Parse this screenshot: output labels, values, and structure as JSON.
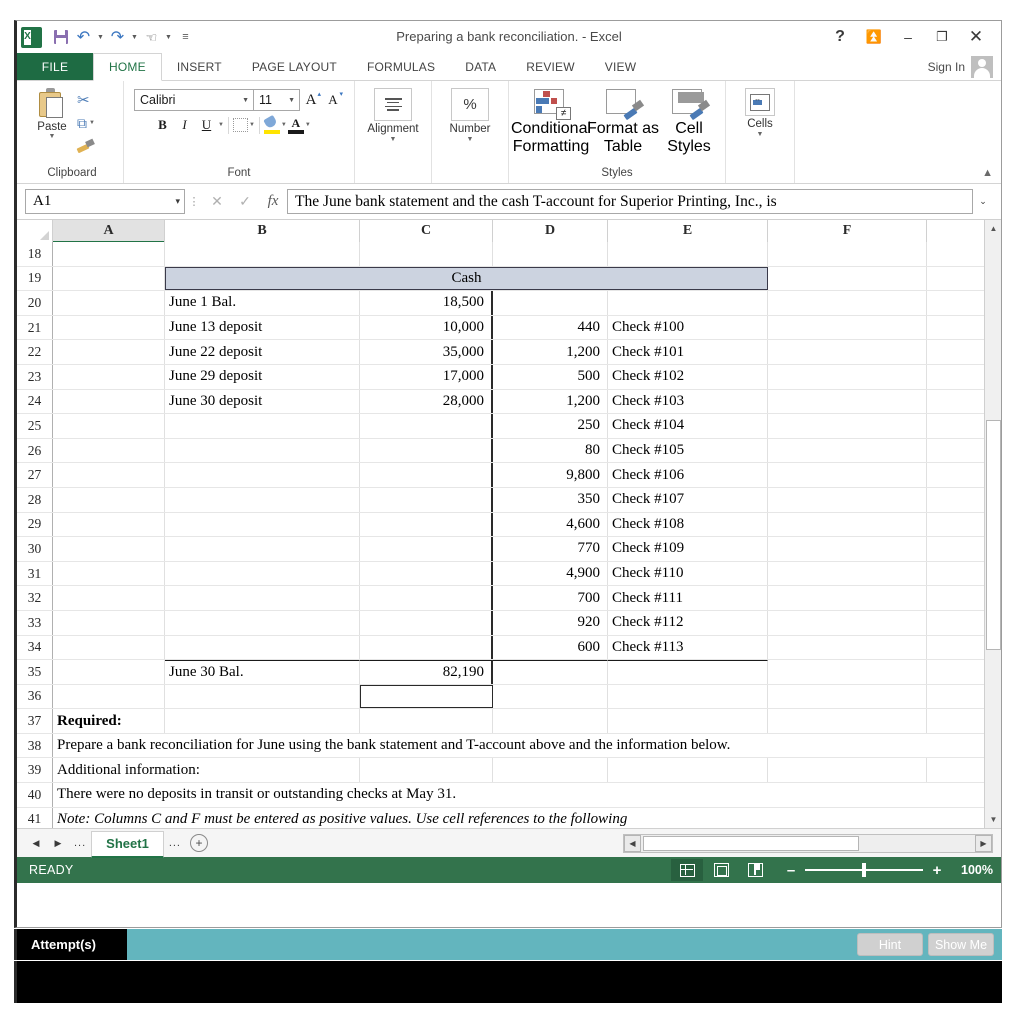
{
  "window": {
    "title": "Preparing a bank reconciliation. - Excel",
    "qat": [
      {
        "name": "save",
        "icon": "save-icon"
      },
      {
        "name": "undo",
        "icon": "undo-icon"
      },
      {
        "name": "redo",
        "icon": "redo-icon"
      },
      {
        "name": "touch-mode",
        "icon": "touch-mode-icon"
      },
      {
        "name": "customize",
        "icon": "more-icon"
      }
    ],
    "controls": {
      "help": "?",
      "ribbon_display": "⤒",
      "minimize": "–",
      "restore": "❐",
      "close": "✕"
    }
  },
  "ribbon": {
    "file_tab": "FILE",
    "tabs": [
      "HOME",
      "INSERT",
      "PAGE LAYOUT",
      "FORMULAS",
      "DATA",
      "REVIEW",
      "VIEW"
    ],
    "active_tab": "HOME",
    "sign_in": "Sign In",
    "collapse_icon": "chevron-up-icon",
    "groups": {
      "clipboard": {
        "label": "Clipboard",
        "paste": "Paste",
        "cut": "cut-icon",
        "copy": "copy-icon",
        "format_painter": "format-painter-icon"
      },
      "font": {
        "label": "Font",
        "font_name": "Calibri",
        "font_size": "11",
        "grow_font": "A",
        "shrink_font": "A",
        "bold": "B",
        "italic": "I",
        "underline": "U",
        "borders": "borders-icon",
        "fill_color": "fill-color-icon",
        "font_color": "A"
      },
      "alignment": {
        "label": "Alignment"
      },
      "number": {
        "label": "Number",
        "symbol": "%"
      },
      "styles": {
        "label": "Styles",
        "conditional_formatting_l1": "Conditional",
        "conditional_formatting_l2": "Formatting",
        "format_as_table_l1": "Format as",
        "format_as_table_l2": "Table",
        "cell_styles_l1": "Cell",
        "cell_styles_l2": "Styles"
      },
      "cells": {
        "label": "Cells"
      }
    }
  },
  "formula_bar": {
    "name_box": "A1",
    "cancel": "✕",
    "enter": "✓",
    "insert_function": "fx",
    "value": "The June bank statement and the cash T-account for Superior Printing, Inc., is",
    "expand": "⌄"
  },
  "grid": {
    "columns": [
      "A",
      "B",
      "C",
      "D",
      "E",
      "F"
    ],
    "selected_column": "A",
    "rows": [
      {
        "n": "18",
        "B": "",
        "C": "",
        "D": "",
        "E": "",
        "F": ""
      },
      {
        "n": "19",
        "type": "cash-header",
        "label": "Cash"
      },
      {
        "n": "20",
        "B": "June 1 Bal.",
        "C": "18,500",
        "D": "",
        "E": "",
        "F": ""
      },
      {
        "n": "21",
        "B": "June 13 deposit",
        "C": "10,000",
        "D": "440",
        "E": "Check #100",
        "F": ""
      },
      {
        "n": "22",
        "B": "June 22 deposit",
        "C": "35,000",
        "D": "1,200",
        "E": "Check #101",
        "F": ""
      },
      {
        "n": "23",
        "B": "June 29 deposit",
        "C": "17,000",
        "D": "500",
        "E": "Check #102",
        "F": ""
      },
      {
        "n": "24",
        "B": "June 30 deposit",
        "C": "28,000",
        "D": "1,200",
        "E": "Check #103",
        "F": ""
      },
      {
        "n": "25",
        "B": "",
        "C": "",
        "D": "250",
        "E": "Check #104",
        "F": ""
      },
      {
        "n": "26",
        "B": "",
        "C": "",
        "D": "80",
        "E": "Check #105",
        "F": ""
      },
      {
        "n": "27",
        "B": "",
        "C": "",
        "D": "9,800",
        "E": "Check #106",
        "F": ""
      },
      {
        "n": "28",
        "B": "",
        "C": "",
        "D": "350",
        "E": "Check #107",
        "F": ""
      },
      {
        "n": "29",
        "B": "",
        "C": "",
        "D": "4,600",
        "E": "Check #108",
        "F": ""
      },
      {
        "n": "30",
        "B": "",
        "C": "",
        "D": "770",
        "E": "Check #109",
        "F": ""
      },
      {
        "n": "31",
        "B": "",
        "C": "",
        "D": "4,900",
        "E": "Check #110",
        "F": ""
      },
      {
        "n": "32",
        "B": "",
        "C": "",
        "D": "700",
        "E": "Check #111",
        "F": ""
      },
      {
        "n": "33",
        "B": "",
        "C": "",
        "D": "920",
        "E": "Check #112",
        "F": ""
      },
      {
        "n": "34",
        "B": "",
        "C": "",
        "D": "600",
        "E": "Check #113",
        "F": ""
      },
      {
        "n": "35",
        "B": "June 30 Bal.",
        "C": "82,190",
        "D": "",
        "E": "",
        "F": ""
      },
      {
        "n": "36",
        "B": "",
        "C": "",
        "D": "",
        "E": "",
        "F": ""
      },
      {
        "n": "37",
        "type": "text-bold",
        "text": "Required:"
      },
      {
        "n": "38",
        "type": "text-wide",
        "text": "Prepare a bank reconciliation for June using the bank statement and T-account above and the information below."
      },
      {
        "n": "39",
        "type": "text-wide",
        "text": "Additional information:"
      },
      {
        "n": "40",
        "type": "text-wide",
        "text": "There were no deposits in transit or outstanding checks at May 31."
      },
      {
        "n": "41",
        "type": "text-italic",
        "text": "Note: Columns C and F must be entered as positive values.  Use cell references to the following"
      }
    ]
  },
  "sheet_tabs": {
    "first_icon": "first-sheet-icon",
    "prev_icon": "prev-sheet-icon",
    "left_dots": "...",
    "active_sheet": "Sheet1",
    "right_dots": "...",
    "add_sheet": "+"
  },
  "status_bar": {
    "mode": "READY",
    "views": [
      "normal-view-icon",
      "page-layout-icon",
      "page-break-icon"
    ],
    "active_view": "normal-view-icon",
    "zoom_out": "–",
    "zoom_in": "+",
    "zoom_level": "100%"
  },
  "attempt_bar": {
    "label": "Attempt(s)",
    "hint_button": "Hint",
    "show_me_button": "Show Me"
  }
}
